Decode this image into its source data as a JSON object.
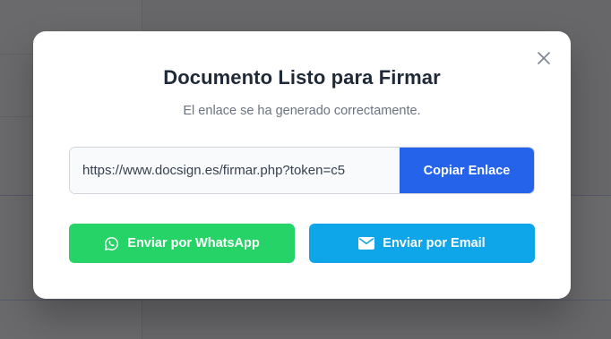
{
  "modal": {
    "title": "Documento Listo para Firmar",
    "subtitle": "El enlace se ha generado correctamente.",
    "link_value": "https://www.docsign.es/firmar.php?token=c5",
    "copy_label": "Copiar Enlace",
    "whatsapp_label": "Enviar por WhatsApp",
    "email_label": "Enviar por Email",
    "colors": {
      "copy_button": "#2563eb",
      "whatsapp_button": "#25d366",
      "email_button": "#0ea5e9"
    },
    "icons": {
      "close": "close-icon",
      "whatsapp": "whatsapp-icon",
      "email": "envelope-icon"
    }
  }
}
